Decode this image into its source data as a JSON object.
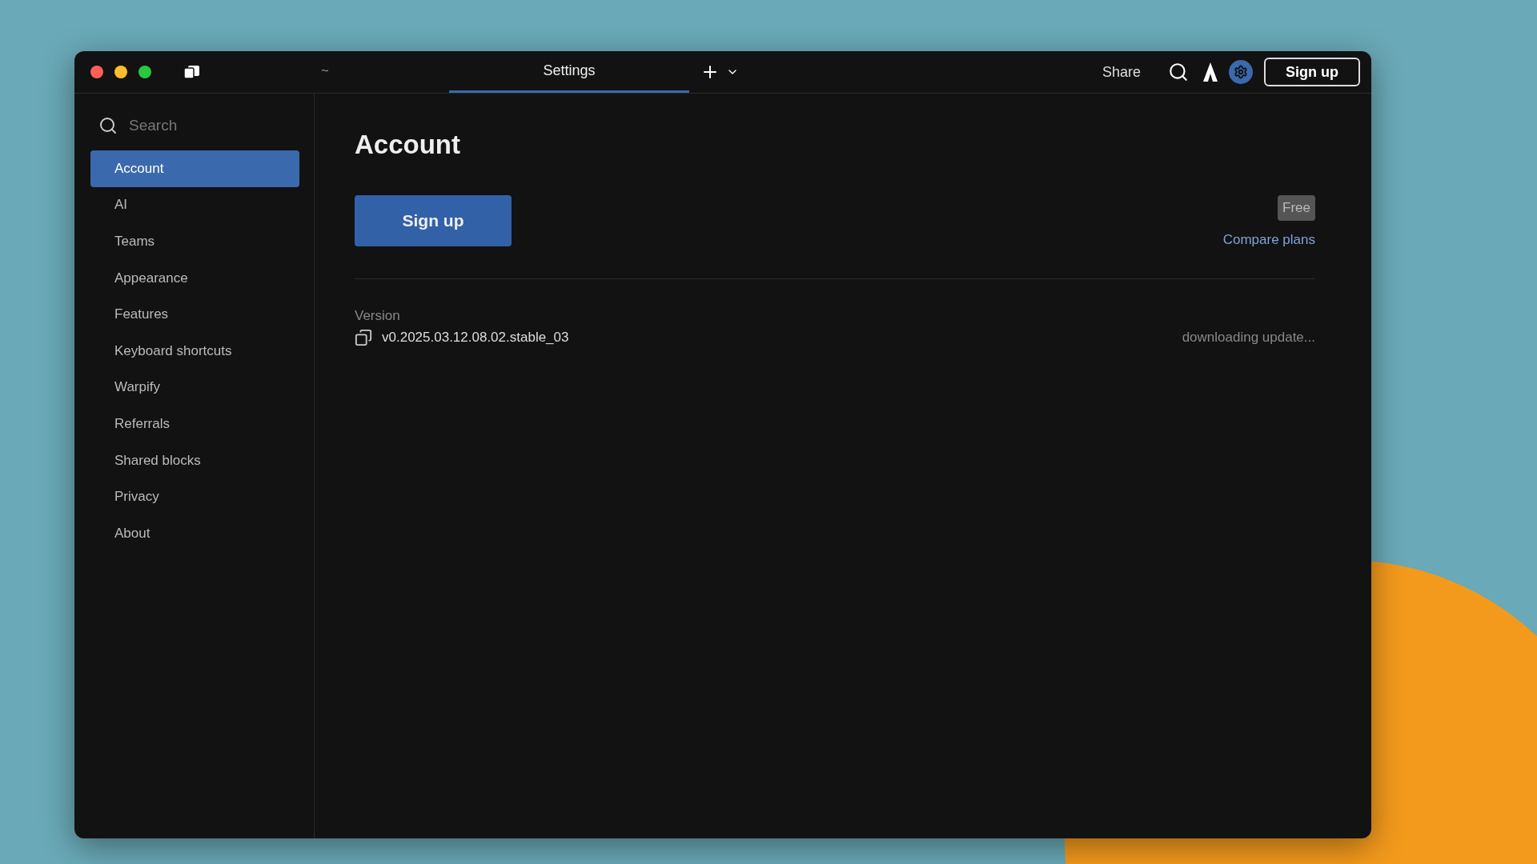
{
  "tabs": [
    {
      "label": "~",
      "selected": false
    },
    {
      "label": "Settings",
      "selected": true
    }
  ],
  "toolbar": {
    "share": "Share",
    "sign_up": "Sign up"
  },
  "sidebar": {
    "search": {
      "placeholder": "Search"
    },
    "items": [
      {
        "label": "Account",
        "selected": true
      },
      {
        "label": "AI",
        "selected": false
      },
      {
        "label": "Teams",
        "selected": false
      },
      {
        "label": "Appearance",
        "selected": false
      },
      {
        "label": "Features",
        "selected": false
      },
      {
        "label": "Keyboard shortcuts",
        "selected": false
      },
      {
        "label": "Warpify",
        "selected": false
      },
      {
        "label": "Referrals",
        "selected": false
      },
      {
        "label": "Shared blocks",
        "selected": false
      },
      {
        "label": "Privacy",
        "selected": false
      },
      {
        "label": "About",
        "selected": false
      }
    ]
  },
  "content": {
    "title": "Account",
    "sign_up": "Sign up",
    "plan": "Free",
    "compare": "Compare plans",
    "version_label": "Version",
    "version": "v0.2025.03.12.08.02.stable_03",
    "update_status": "downloading update..."
  }
}
